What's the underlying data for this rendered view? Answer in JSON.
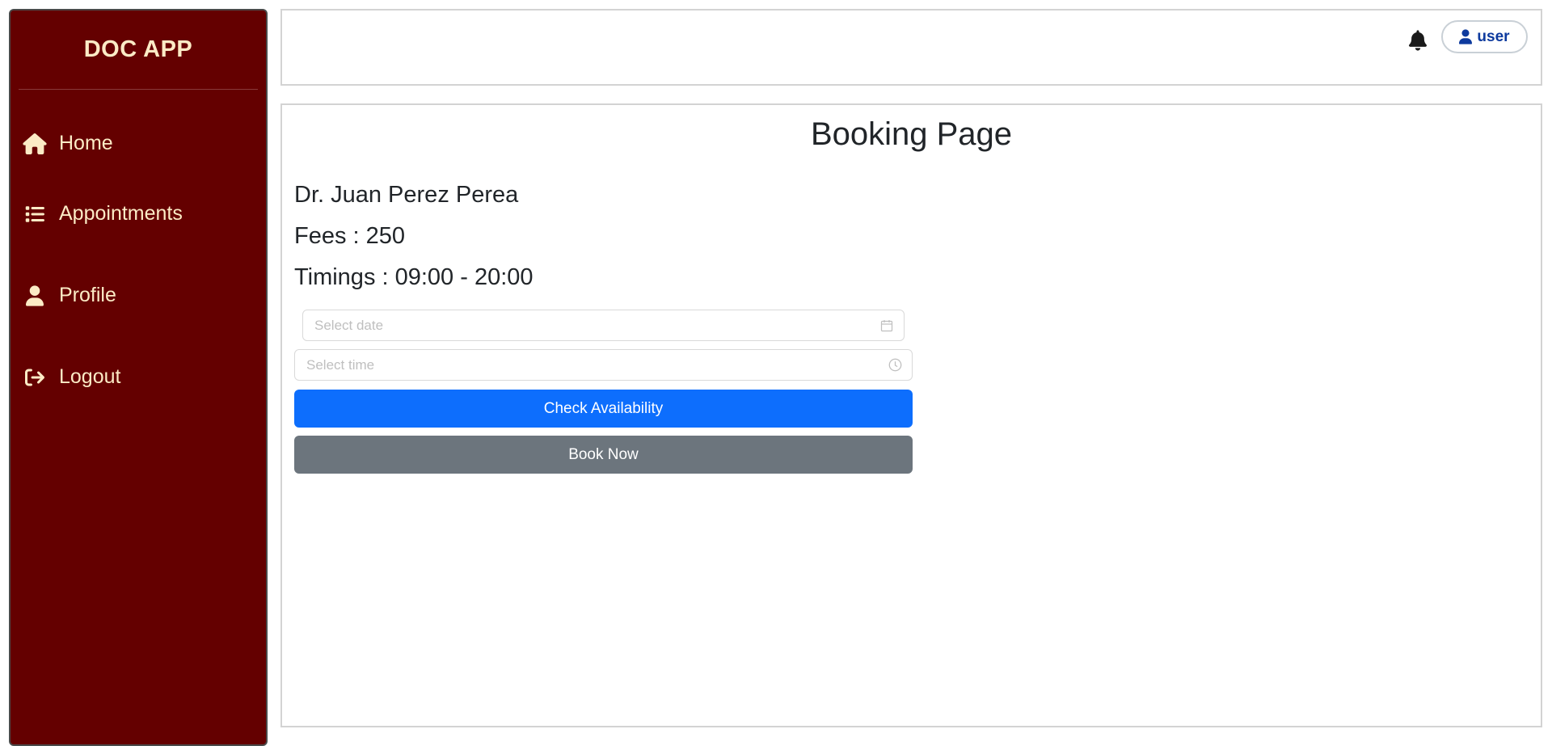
{
  "sidebar": {
    "logo": "DOC APP",
    "items": [
      {
        "label": "Home",
        "icon": "home-icon"
      },
      {
        "label": "Appointments",
        "icon": "list-icon"
      },
      {
        "label": "Profile",
        "icon": "user-icon"
      },
      {
        "label": "Logout",
        "icon": "sign-out-icon"
      }
    ]
  },
  "header": {
    "bell_icon": "bell-icon",
    "user_label": "user"
  },
  "main": {
    "title": "Booking Page",
    "doctor_name": "Dr. Juan Perez Perea",
    "fees": "Fees : 250",
    "timings": "Timings : 09:00 - 20:00",
    "date_placeholder": "Select date",
    "time_placeholder": "Select time",
    "check_button": "Check Availability",
    "book_button": "Book Now"
  },
  "colors": {
    "sidebar_bg": "#640000",
    "sidebar_text": "#fcebc6",
    "primary": "#0d6efd",
    "secondary": "#6c757d",
    "user_text": "#0d3a9e"
  }
}
